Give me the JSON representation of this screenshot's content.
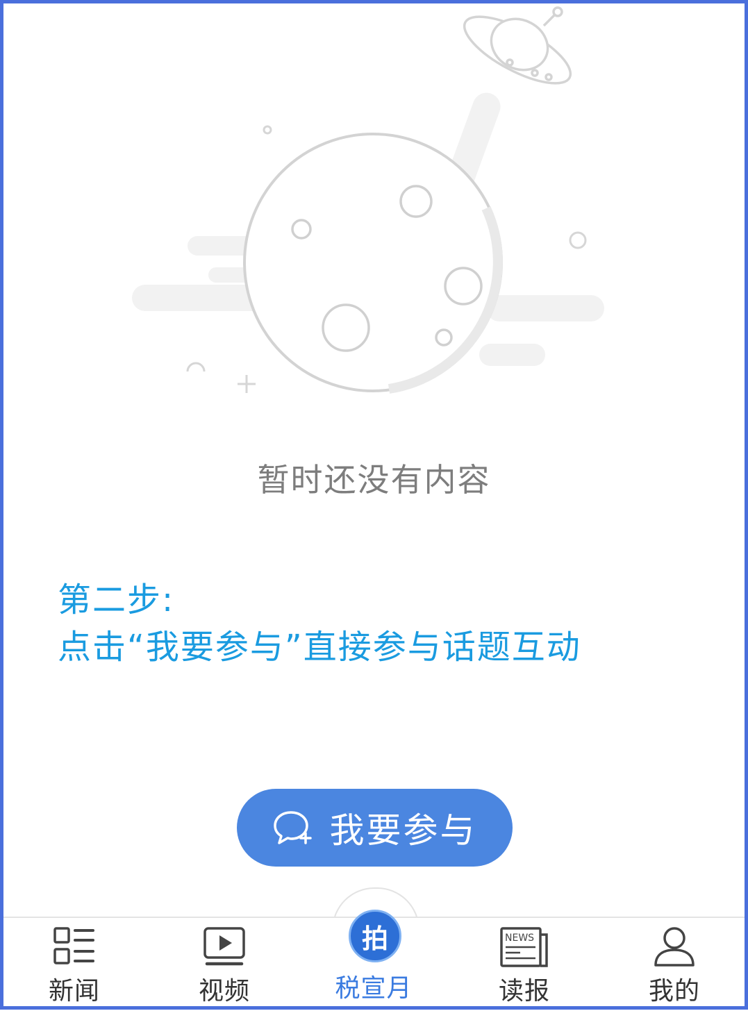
{
  "empty_state": {
    "message": "暂时还没有内容"
  },
  "instruction": {
    "step": "第二步:",
    "text": "点击“我要参与”直接参与话题互动"
  },
  "join_button": {
    "label": "我要参与",
    "icon": "chat-plus-icon"
  },
  "tabbar": {
    "active_index": 2,
    "center_badge": "拍",
    "items": [
      {
        "label": "新闻",
        "icon": "list-icon"
      },
      {
        "label": "视频",
        "icon": "play-icon"
      },
      {
        "label": "税宣月",
        "icon": "pai-badge-icon"
      },
      {
        "label": "读报",
        "icon": "newspaper-icon"
      },
      {
        "label": "我的",
        "icon": "person-icon"
      }
    ]
  },
  "colors": {
    "accent": "#1a9be0",
    "button": "#4b86e0",
    "tab_active": "#3a7be0",
    "frame": "#4a6fdc",
    "muted_text": "#7d7d7d"
  }
}
